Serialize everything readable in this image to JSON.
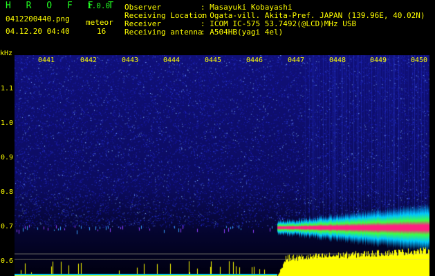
{
  "header": {
    "app_title": "H R O F F T",
    "version": "1.0.0",
    "filename": "0412200440.png",
    "datetime": "04.12.20 04:40",
    "event_label": "meteor",
    "event_count": "16"
  },
  "info": [
    {
      "key": "Observer",
      "value": ": Masayuki Kobayashi"
    },
    {
      "key": "Receiving Location",
      "value": ": Ogata-vill. Akita-Pref. JAPAN (139.96E, 40.02N)"
    },
    {
      "key": "Receiver",
      "value": ": ICOM IC-575 53.7492(@LCD)MHz USB"
    },
    {
      "key": "Receiving antenna",
      "value": ": A504HB(yagi 4el)"
    }
  ],
  "axis": {
    "unit": "kHz",
    "freq_ticks": [
      "1.1",
      "1.0",
      "0.9",
      "0.8",
      "0.7",
      "0.6"
    ],
    "time_ticks": [
      "0441",
      "0442",
      "0443",
      "0444",
      "0445",
      "0446",
      "0447",
      "0448",
      "0449",
      "0450"
    ]
  },
  "colors": {
    "header_text": "#ffff00",
    "title_text": "#22ff22",
    "background": "#000000",
    "noise_blue": "#1414a0",
    "signal_band": "#ff2080",
    "power_plot": "#ffff00"
  }
}
